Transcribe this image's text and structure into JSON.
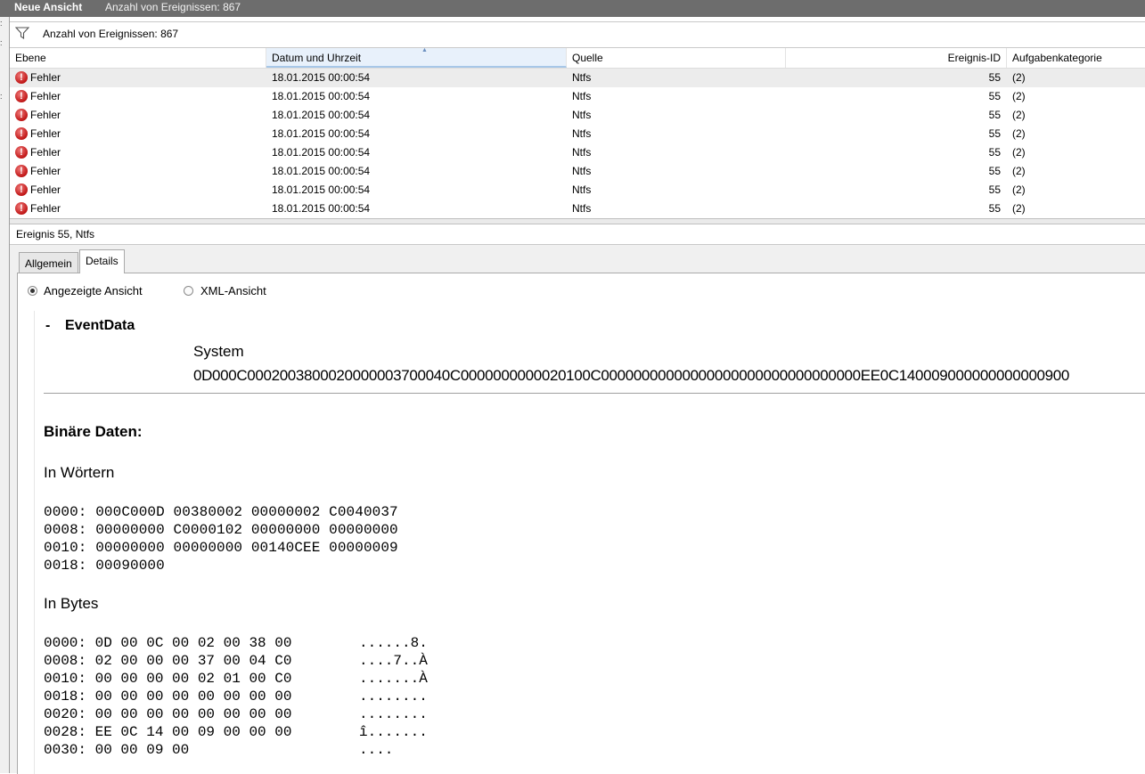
{
  "title_bar": {
    "view_name": "Neue Ansicht",
    "event_count": "Anzahl von Ereignissen: 867"
  },
  "filter_bar": {
    "icon": "filter-icon",
    "text": "Anzahl von Ereignissen: 867"
  },
  "grid": {
    "columns": [
      "Ebene",
      "Datum und Uhrzeit",
      "Quelle",
      "Ereignis-ID",
      "Aufgabenkategorie"
    ],
    "rows": [
      {
        "level": "Fehler",
        "datetime": "18.01.2015 00:00:54",
        "source": "Ntfs",
        "event_id": "55",
        "category": "(2)"
      },
      {
        "level": "Fehler",
        "datetime": "18.01.2015 00:00:54",
        "source": "Ntfs",
        "event_id": "55",
        "category": "(2)"
      },
      {
        "level": "Fehler",
        "datetime": "18.01.2015 00:00:54",
        "source": "Ntfs",
        "event_id": "55",
        "category": "(2)"
      },
      {
        "level": "Fehler",
        "datetime": "18.01.2015 00:00:54",
        "source": "Ntfs",
        "event_id": "55",
        "category": "(2)"
      },
      {
        "level": "Fehler",
        "datetime": "18.01.2015 00:00:54",
        "source": "Ntfs",
        "event_id": "55",
        "category": "(2)"
      },
      {
        "level": "Fehler",
        "datetime": "18.01.2015 00:00:54",
        "source": "Ntfs",
        "event_id": "55",
        "category": "(2)"
      },
      {
        "level": "Fehler",
        "datetime": "18.01.2015 00:00:54",
        "source": "Ntfs",
        "event_id": "55",
        "category": "(2)"
      },
      {
        "level": "Fehler",
        "datetime": "18.01.2015 00:00:54",
        "source": "Ntfs",
        "event_id": "55",
        "category": "(2)"
      }
    ]
  },
  "event_header": "Ereignis 55, Ntfs",
  "tabs": {
    "general": "Allgemein",
    "details": "Details"
  },
  "view_options": {
    "friendly": "Angezeigte Ansicht",
    "xml": "XML-Ansicht"
  },
  "event_data": {
    "heading": "EventData",
    "collapse_symbol": "-",
    "system_label": "System",
    "system_value": "0D000C0002003800020000003700040C0000000000020100C00000000000000000000000000000000EE0C140009000000000000900"
  },
  "binary": {
    "title": "Binäre Daten:",
    "words_label": "In Wörtern",
    "words": [
      "0000: 000C000D 00380002 00000002 C0040037",
      "0008: 00000000 C0000102 00000000 00000000",
      "0010: 00000000 00000000 00140CEE 00000009",
      "0018: 00090000"
    ],
    "bytes_label": "In Bytes",
    "bytes_hex": [
      "0000: 0D 00 0C 00 02 00 38 00",
      "0008: 02 00 00 00 37 00 04 C0",
      "0010: 00 00 00 00 02 01 00 C0",
      "0018: 00 00 00 00 00 00 00 00",
      "0020: 00 00 00 00 00 00 00 00",
      "0028: EE 0C 14 00 09 00 00 00",
      "0030: 00 00 09 00"
    ],
    "bytes_ascii": [
      "......8.",
      "....7..À",
      ".......À",
      "........",
      "........",
      "î.......",
      "...."
    ]
  }
}
